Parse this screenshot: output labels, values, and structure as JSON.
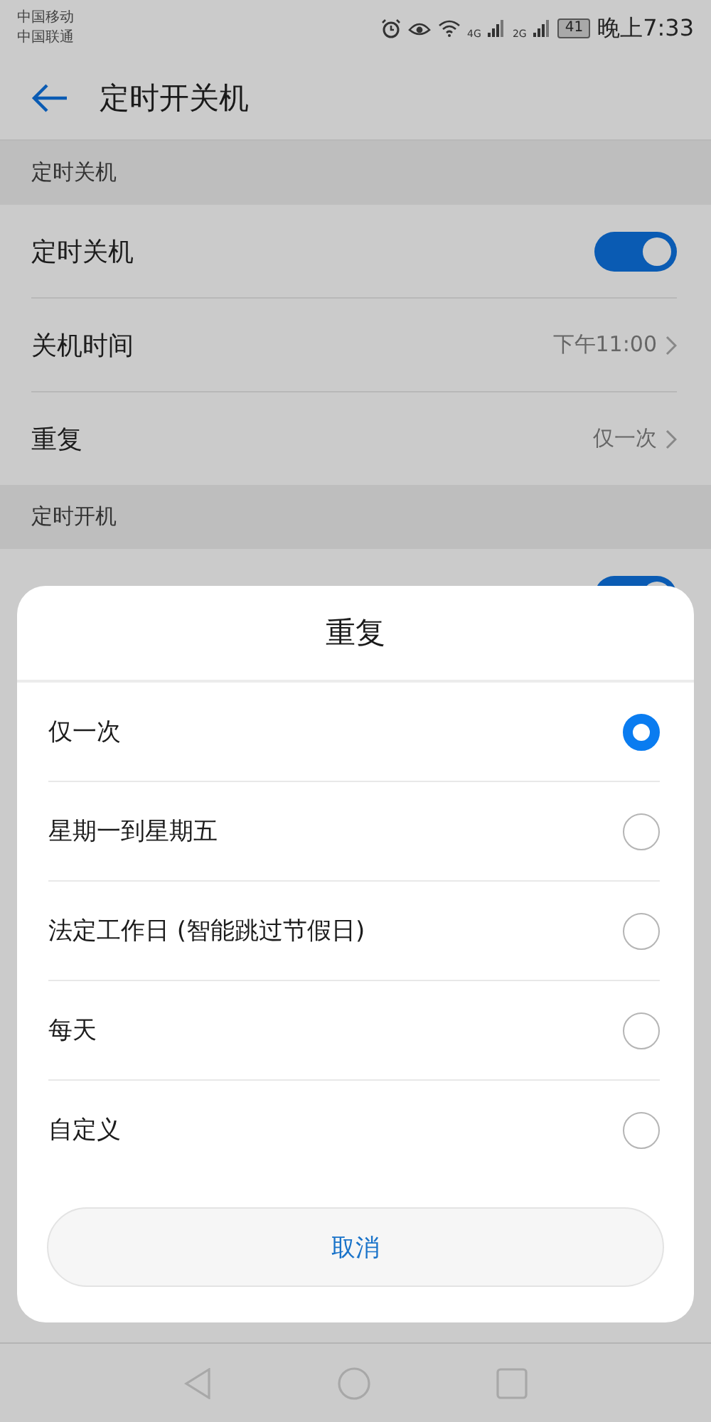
{
  "status_bar": {
    "carriers": [
      "中国移动",
      "中国联通"
    ],
    "network_labels": [
      "4G",
      "2G"
    ],
    "battery": "41",
    "time": "晚上7:33"
  },
  "header": {
    "title": "定时开关机"
  },
  "sections": [
    {
      "title": "定时关机",
      "rows": [
        {
          "kind": "toggle",
          "label": "定时关机",
          "on": true
        },
        {
          "kind": "value",
          "label": "关机时间",
          "value": "下午11:00"
        },
        {
          "kind": "value",
          "label": "重复",
          "value": "仅一次"
        }
      ]
    },
    {
      "title": "定时开机",
      "rows": [
        {
          "kind": "toggle",
          "on": true
        }
      ]
    }
  ],
  "dialog": {
    "title": "重复",
    "options": [
      {
        "label": "仅一次",
        "selected": true
      },
      {
        "label": "星期一到星期五",
        "selected": false
      },
      {
        "label": "法定工作日 (智能跳过节假日)",
        "selected": false
      },
      {
        "label": "每天",
        "selected": false
      },
      {
        "label": "自定义",
        "selected": false
      }
    ],
    "cancel": "取消"
  }
}
